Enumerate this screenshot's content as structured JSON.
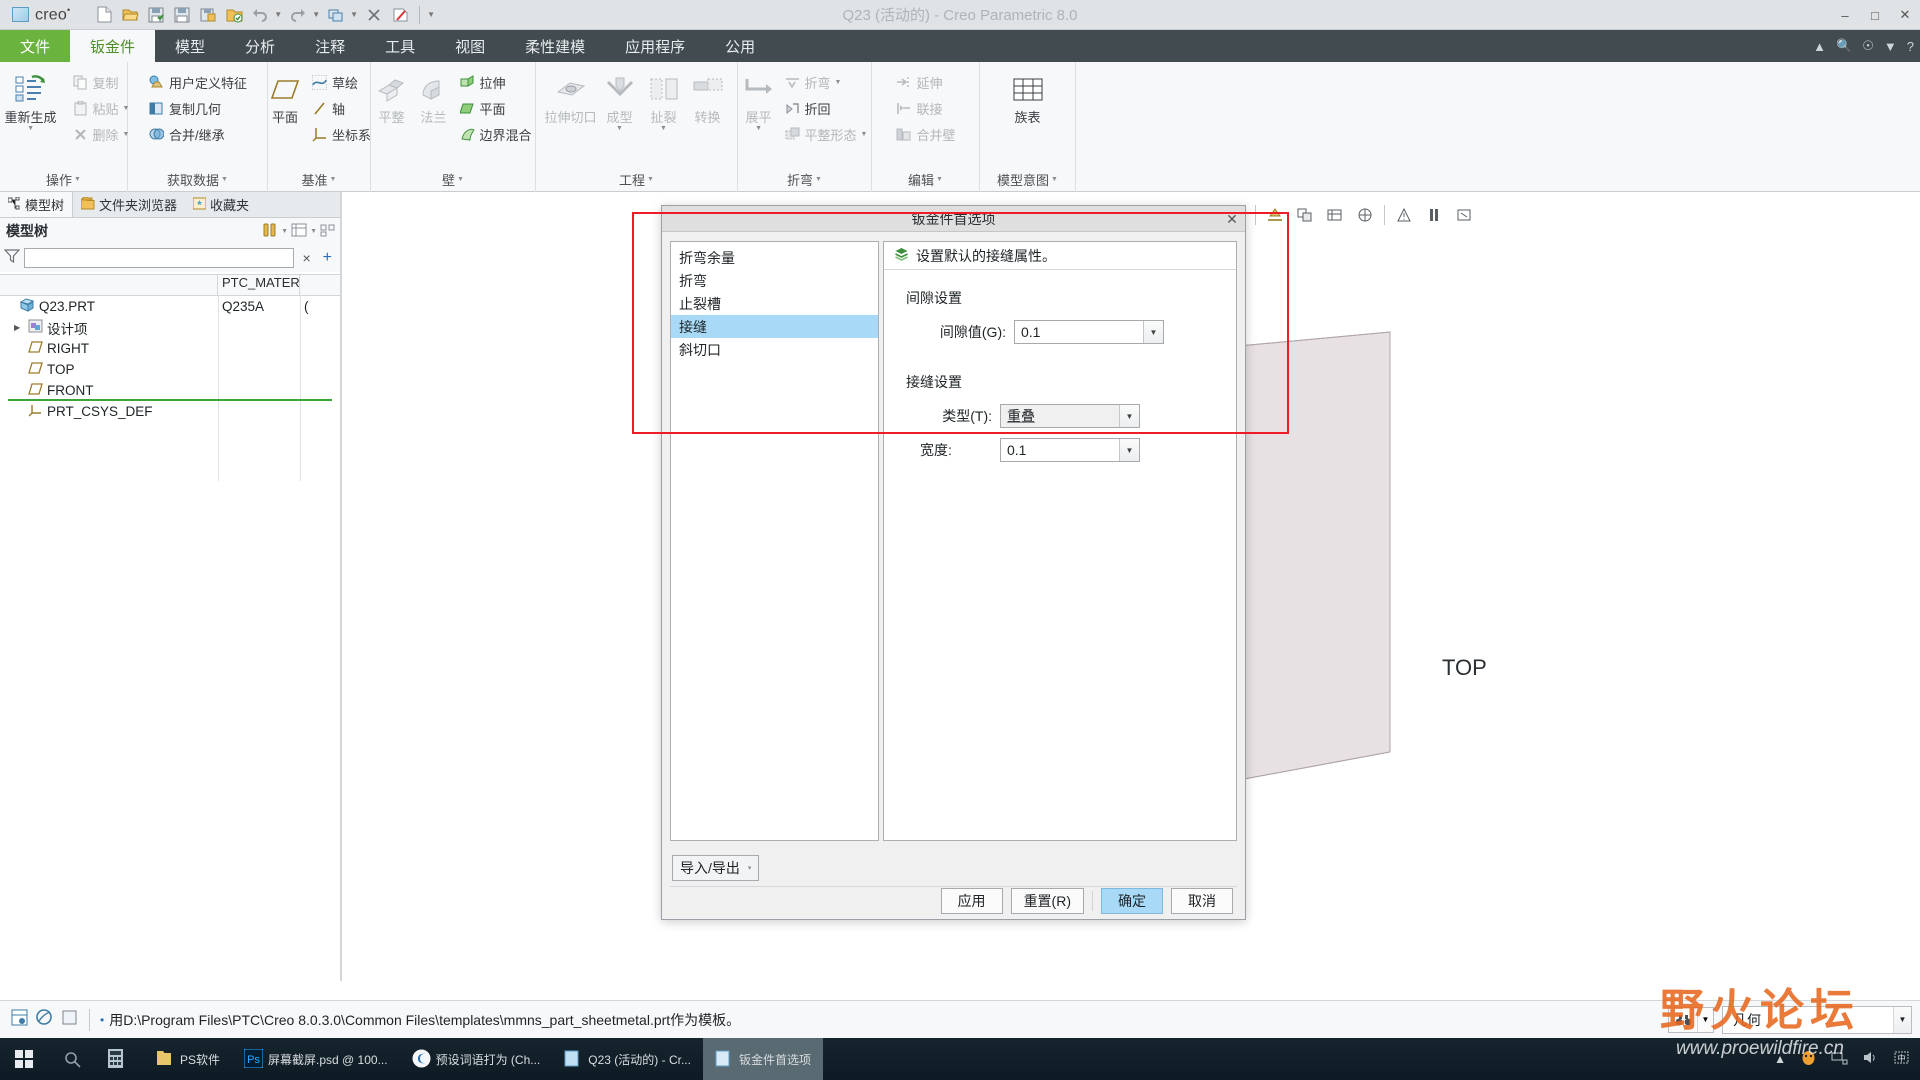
{
  "titlebar": {
    "brand": "creo",
    "title": "Q23 (活动的) - Creo Parametric 8.0",
    "qat": [
      {
        "name": "new-file-icon",
        "label": "新建"
      },
      {
        "name": "open-file-icon",
        "label": "打开"
      },
      {
        "name": "save-icon",
        "label": "保存"
      },
      {
        "name": "save-as-icon",
        "label": "另存为"
      },
      {
        "name": "save-copy-icon",
        "label": "保存副本"
      },
      {
        "name": "print-icon",
        "label": "打印"
      },
      {
        "name": "undo-icon",
        "label": "撤消"
      },
      {
        "name": "redo-icon",
        "label": "重做"
      },
      {
        "name": "regenerate-icon",
        "label": "重新生成"
      },
      {
        "name": "close-window-icon",
        "label": "关闭"
      },
      {
        "name": "erase-icon",
        "label": "拭除"
      }
    ],
    "window_controls": [
      "minimize",
      "maximize",
      "close"
    ]
  },
  "ribbon": {
    "tabs": [
      {
        "label": "文件",
        "state": "file"
      },
      {
        "label": "钣金件",
        "state": "active"
      },
      {
        "label": "模型",
        "state": "normal"
      },
      {
        "label": "分析",
        "state": "normal"
      },
      {
        "label": "注释",
        "state": "normal"
      },
      {
        "label": "工具",
        "state": "normal"
      },
      {
        "label": "视图",
        "state": "normal"
      },
      {
        "label": "柔性建模",
        "state": "normal"
      },
      {
        "label": "应用程序",
        "state": "normal"
      },
      {
        "label": "公用",
        "state": "normal"
      }
    ],
    "right_icons": [
      "chevron-up-icon",
      "search-icon",
      "account-icon",
      "chevron-down-icon",
      "help-icon"
    ],
    "groups": [
      {
        "label": "操作",
        "big": [
          {
            "label": "重新生成",
            "icon": "regenerate-icon",
            "disabled": false,
            "dropdown": true
          }
        ],
        "small": [
          {
            "label": "复制",
            "icon": "copy-icon",
            "disabled": true,
            "dropdown": false
          },
          {
            "label": "粘贴",
            "icon": "paste-icon",
            "disabled": true,
            "dropdown": true
          },
          {
            "label": "删除",
            "icon": "delete-icon",
            "disabled": true,
            "dropdown": true
          }
        ]
      },
      {
        "label": "获取数据",
        "big": [],
        "small": [
          {
            "label": "用户定义特征",
            "icon": "udf-icon",
            "disabled": false,
            "dropdown": false
          },
          {
            "label": "复制几何",
            "icon": "copy-geometry-icon",
            "disabled": false,
            "dropdown": false
          },
          {
            "label": "合并/继承",
            "icon": "merge-inherit-icon",
            "disabled": false,
            "dropdown": false
          }
        ]
      },
      {
        "label": "基准",
        "big": [
          {
            "label": "平面",
            "icon": "datum-plane-icon",
            "disabled": false,
            "dropdown": false
          }
        ],
        "small": [
          {
            "label": "草绘",
            "icon": "sketch-icon",
            "disabled": false,
            "dropdown": false
          },
          {
            "label": "轴",
            "icon": "datum-axis-icon",
            "disabled": false,
            "dropdown": false
          },
          {
            "label": "坐标系",
            "icon": "coordinate-system-icon",
            "disabled": false,
            "dropdown": false
          }
        ]
      },
      {
        "label": "壁",
        "big": [
          {
            "label": "平整",
            "icon": "flat-wall-icon",
            "disabled": true,
            "dropdown": false
          },
          {
            "label": "法兰",
            "icon": "flange-wall-icon",
            "disabled": true,
            "dropdown": false
          }
        ],
        "small": [
          {
            "label": "拉伸",
            "icon": "extrude-icon",
            "disabled": false,
            "dropdown": false
          },
          {
            "label": "平面",
            "icon": "planar-icon",
            "disabled": false,
            "dropdown": false
          },
          {
            "label": "边界混合",
            "icon": "boundary-blend-icon",
            "disabled": false,
            "dropdown": false
          }
        ]
      },
      {
        "label": "工程",
        "big": [
          {
            "label": "拉伸切口",
            "icon": "extrude-cut-icon",
            "disabled": true,
            "dropdown": false
          },
          {
            "label": "成型",
            "icon": "form-icon",
            "disabled": true,
            "dropdown": true
          },
          {
            "label": "扯裂",
            "icon": "rip-icon",
            "disabled": true,
            "dropdown": true
          },
          {
            "label": "转换",
            "icon": "convert-icon",
            "disabled": true,
            "dropdown": false
          }
        ],
        "small": []
      },
      {
        "label": "折弯",
        "big": [
          {
            "label": "展平",
            "icon": "unbend-icon",
            "disabled": true,
            "dropdown": true
          }
        ],
        "small": [
          {
            "label": "折弯",
            "icon": "bend-icon",
            "disabled": true,
            "dropdown": true
          },
          {
            "label": "折回",
            "icon": "bend-back-icon",
            "disabled": false,
            "dropdown": false
          },
          {
            "label": "平整形态",
            "icon": "flat-state-icon",
            "disabled": true,
            "dropdown": true
          }
        ]
      },
      {
        "label": "编辑",
        "big": [],
        "small": [
          {
            "label": "延伸",
            "icon": "extend-icon",
            "disabled": true,
            "dropdown": false
          },
          {
            "label": "联接",
            "icon": "merge-icon",
            "disabled": true,
            "dropdown": false
          },
          {
            "label": "合并壁",
            "icon": "merge-walls-icon",
            "disabled": true,
            "dropdown": false
          }
        ]
      },
      {
        "label": "模型意图",
        "big": [
          {
            "label": "族表",
            "icon": "family-table-icon",
            "disabled": false,
            "dropdown": false
          }
        ],
        "small": []
      }
    ]
  },
  "left_panel": {
    "nav_tabs": [
      {
        "label": "模型树",
        "icon": "model-tree-icon",
        "active": true
      },
      {
        "label": "文件夹浏览器",
        "icon": "folder-browser-icon",
        "active": false
      },
      {
        "label": "收藏夹",
        "icon": "favorites-icon",
        "active": false
      }
    ],
    "header": "模型树",
    "header_icons": [
      "settings-tools-icon",
      "chevron-down-icon",
      "display-icon",
      "column-icon"
    ],
    "filter": {
      "placeholder": "",
      "value": "",
      "icon": "filter-icon",
      "clear": "×",
      "add": "+"
    },
    "columns": [
      "",
      "PTC_MATERIAL_",
      ""
    ],
    "rows": [
      {
        "label": "Q23.PRT",
        "icon": "part-icon",
        "indent": 0,
        "expander": false,
        "material": "Q235A",
        "extra": "("
      },
      {
        "label": "设计项",
        "icon": "design-items-icon",
        "indent": 1,
        "expander": true,
        "material": "",
        "extra": ""
      },
      {
        "label": "RIGHT",
        "icon": "datum-plane-icon",
        "indent": 1,
        "expander": false,
        "material": "",
        "extra": ""
      },
      {
        "label": "TOP",
        "icon": "datum-plane-icon",
        "indent": 1,
        "expander": false,
        "material": "",
        "extra": ""
      },
      {
        "label": "FRONT",
        "icon": "datum-plane-icon",
        "indent": 1,
        "expander": false,
        "material": "",
        "extra": ""
      },
      {
        "label": "PRT_CSYS_DEF",
        "icon": "coordinate-system-icon",
        "indent": 1,
        "expander": false,
        "material": "",
        "extra": ""
      }
    ]
  },
  "graphics": {
    "toolbar_icons": [
      "repaint-icon",
      "zoom-in-icon",
      "zoom-out-icon",
      "refit-icon",
      "saved-views-icon",
      "view-manager-icon",
      "appearance-icon",
      "annotation-display-icon",
      "spin-center-icon",
      "datum-display-icon"
    ],
    "view_label": "TOP"
  },
  "dialog": {
    "title": "钣金件首选项",
    "close": "✕",
    "categories": [
      {
        "label": "折弯余量",
        "selected": false
      },
      {
        "label": "折弯",
        "selected": false
      },
      {
        "label": "止裂槽",
        "selected": false
      },
      {
        "label": "接缝",
        "selected": true
      },
      {
        "label": "斜切口",
        "selected": false
      }
    ],
    "panel_heading": "设置默认的接缝属性。",
    "panel_icon": "seam-properties-icon",
    "sections": [
      {
        "title": "间隙设置",
        "fields": [
          {
            "label": "间隙值(G):",
            "value": "0.1",
            "type": "combo-editable",
            "name": "gap-value-combo"
          }
        ]
      },
      {
        "title": "接缝设置",
        "fields": [
          {
            "label": "类型(T):",
            "value": "重叠",
            "type": "combo-readonly",
            "name": "seam-type-combo"
          },
          {
            "label": "宽度:",
            "value": "0.1",
            "type": "combo-editable",
            "name": "seam-width-combo"
          }
        ]
      }
    ],
    "import_export": {
      "label": "导入/导出",
      "caret": "▾"
    },
    "buttons": [
      {
        "label": "应用",
        "name": "apply-button",
        "primary": false
      },
      {
        "label": "重置(R)",
        "name": "reset-button",
        "primary": false
      },
      {
        "label": "确定",
        "name": "ok-button",
        "primary": true
      },
      {
        "label": "取消",
        "name": "cancel-button",
        "primary": false
      }
    ]
  },
  "statusbar": {
    "icons": [
      "model-info-icon",
      "accuracy-icon",
      "filter-box-icon"
    ],
    "bullet": "•",
    "message": "用D:\\Program Files\\PTC\\Creo 8.0.3.0\\Common Files\\templates\\mmns_part_sheetmetal.prt作为模板。",
    "find_icon": "binoculars-icon",
    "selection_filter": "几何"
  },
  "watermark": {
    "top": "野火论坛",
    "bottom": "www.proewildfire.cn"
  },
  "taskbar": {
    "start_icon": "windows-start-icon",
    "search_icon": "search-icon",
    "items": [
      {
        "label": "",
        "icon": "calculator-icon",
        "active": false
      },
      {
        "label": "PS软件",
        "icon": "folder-icon",
        "active": false
      },
      {
        "label": "屏幕截屏.psd @ 100...",
        "icon": "photoshop-icon",
        "active": false
      },
      {
        "label": "预设词语打为 (Ch...",
        "icon": "sogou-icon",
        "active": false
      },
      {
        "label": "Q23 (活动的) - Cr...",
        "icon": "creo-icon",
        "active": false
      },
      {
        "label": "钣金件首选项",
        "icon": "creo-icon",
        "active": true
      }
    ],
    "tray": [
      "chevron-up-icon",
      "qq-icon",
      "network-icon",
      "volume-icon",
      "ime-icon"
    ]
  }
}
